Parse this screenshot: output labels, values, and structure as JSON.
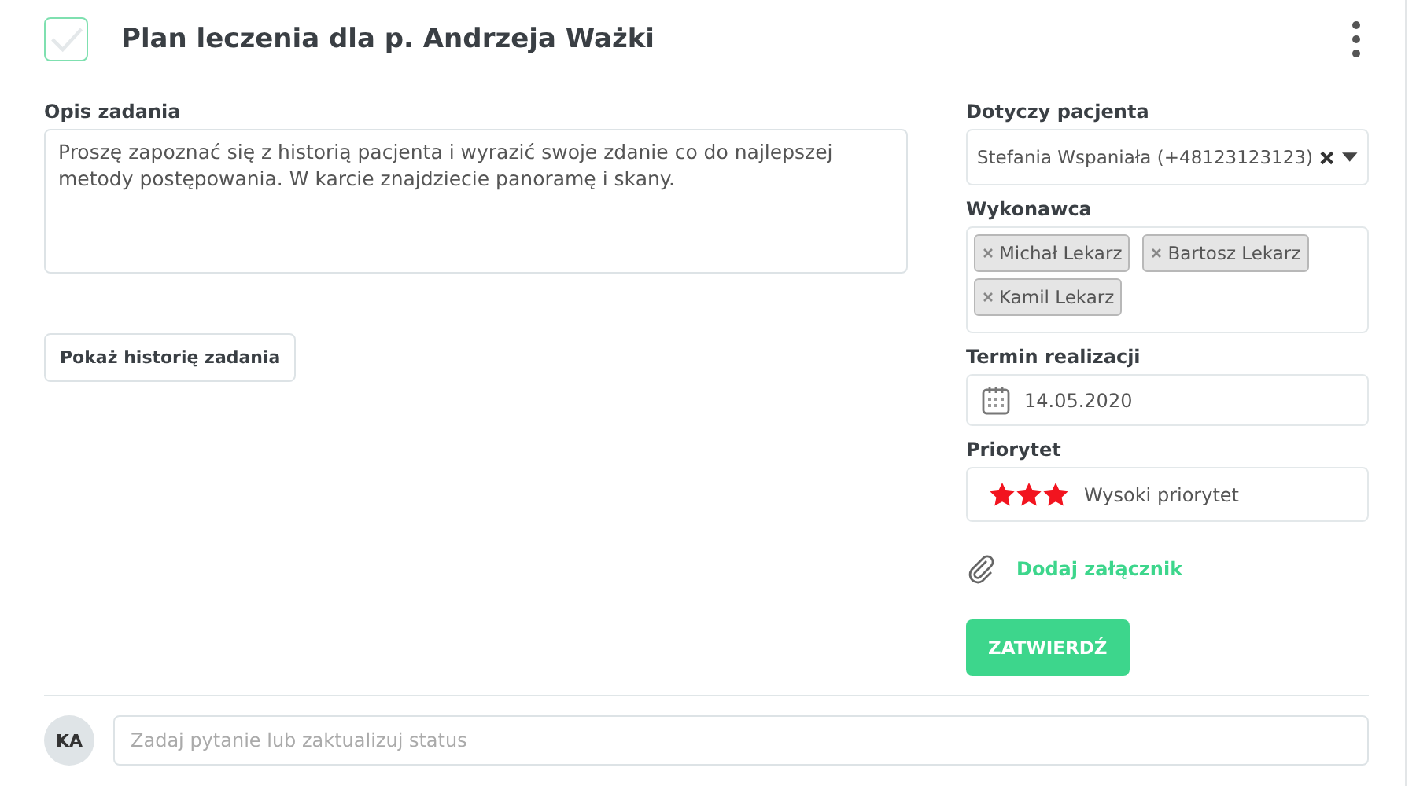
{
  "task": {
    "title": "Plan leczenia dla p. Andrzeja Ważki",
    "done": false
  },
  "description": {
    "label": "Opis zadania",
    "value": "Proszę zapoznać się z historią pacjenta i wyrazić swoje zdanie co do najlepszej metody postępowania. W karcie znajdziecie panoramę i skany."
  },
  "history_button": "Pokaż historię zadania",
  "patient": {
    "label": "Dotyczy pacjenta",
    "value": "Stefania Wspaniała (+48123123123)"
  },
  "assignees": {
    "label": "Wykonawca",
    "tags": [
      "Michał Lekarz",
      "Bartosz Lekarz",
      "Kamil Lekarz"
    ]
  },
  "due_date": {
    "label": "Termin realizacji",
    "value": "14.05.2020"
  },
  "priority": {
    "label": "Priorytet",
    "stars": 3,
    "text": "Wysoki priorytet"
  },
  "attachment_link": "Dodaj załącznik",
  "submit_button": "ZATWIERDŹ",
  "comment": {
    "avatar": "KA",
    "placeholder": "Zadaj pytanie lub zaktualizuj status"
  }
}
